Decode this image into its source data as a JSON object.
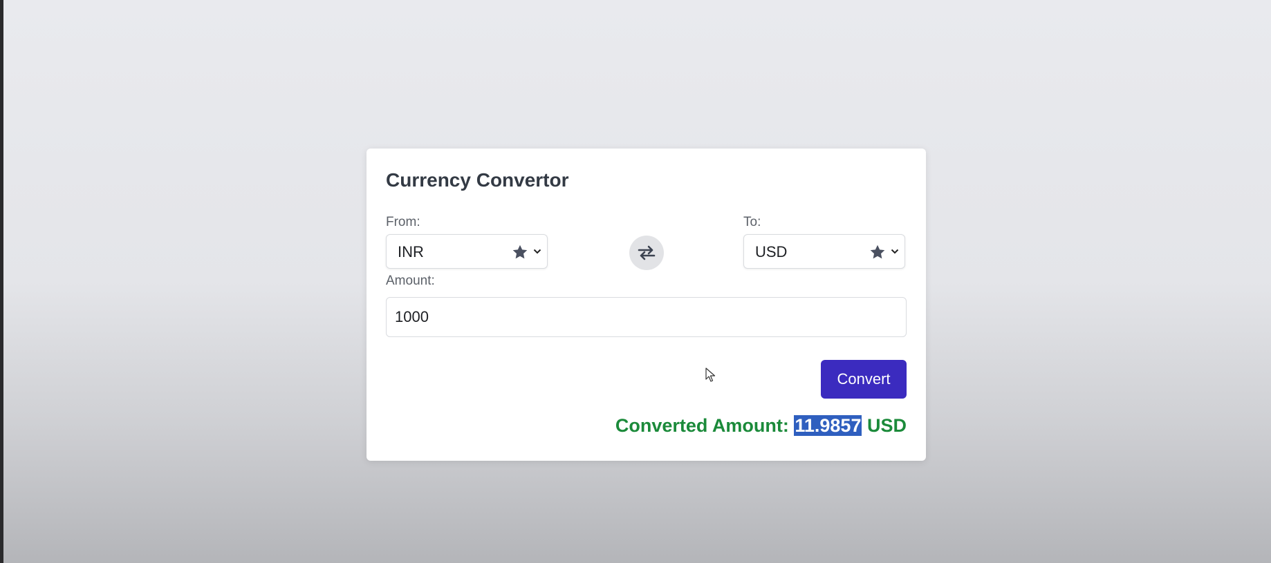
{
  "converter": {
    "title": "Currency Convertor",
    "from_label": "From:",
    "to_label": "To:",
    "from_currency": "INR",
    "to_currency": "USD",
    "amount_label": "Amount:",
    "amount_value": "1000",
    "convert_label": "Convert",
    "result_prefix": "Converted Amount:",
    "result_value": "11.9857",
    "result_currency": "USD"
  },
  "icons": {
    "favorite": "star-icon",
    "dropdown": "chevron-down-icon",
    "swap": "swap-arrows-icon",
    "cursor": "mouse-pointer-icon"
  },
  "colors": {
    "accent": "#3b2bbf",
    "result_text": "#1b8a3a",
    "selection_highlight": "#2f5fbf"
  }
}
